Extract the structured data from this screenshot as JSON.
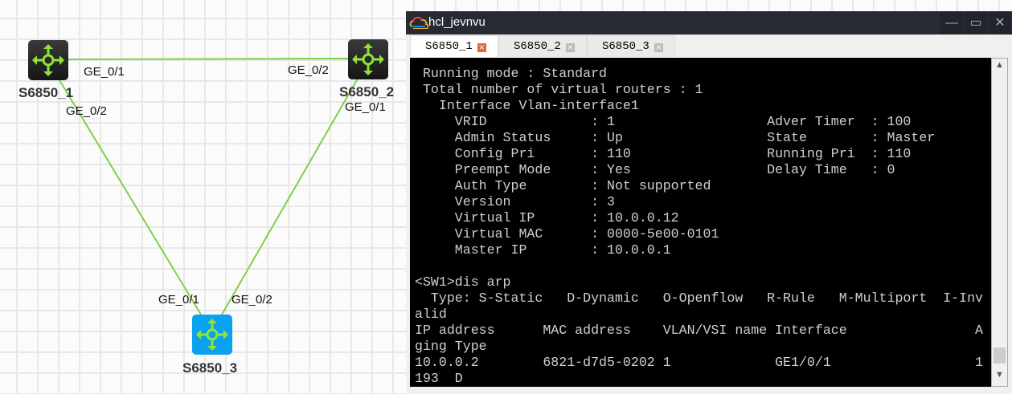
{
  "topology": {
    "devices": [
      {
        "name": "S6850_1",
        "color": "#222222"
      },
      {
        "name": "S6850_2",
        "color": "#222222"
      },
      {
        "name": "S6850_3",
        "color": "#0aa2f0"
      }
    ],
    "link_color": "#7ed04a",
    "ports": {
      "s1_to_s2": "GE_0/1",
      "s2_to_s1": "GE_0/2",
      "s1_to_s3": "GE_0/2",
      "s2_to_s3": "GE_0/1",
      "s3_to_s1": "GE_0/1",
      "s3_to_s2": "GE_0/2"
    }
  },
  "window": {
    "title": "hcl_jevnvu",
    "minimize": "—",
    "maximize": "▭",
    "close": "✕",
    "tabs": [
      {
        "label": "S6850_1",
        "active": true
      },
      {
        "label": "S6850_2",
        "active": false
      },
      {
        "label": "S6850_3",
        "active": false
      }
    ],
    "terminal_lines": [
      " Running mode : Standard",
      " Total number of virtual routers : 1",
      "   Interface Vlan-interface1",
      "     VRID             : 1                   Adver Timer  : 100",
      "     Admin Status     : Up                  State        : Master",
      "     Config Pri       : 110                 Running Pri  : 110",
      "     Preempt Mode     : Yes                 Delay Time   : 0",
      "     Auth Type        : Not supported",
      "     Version          : 3",
      "     Virtual IP       : 10.0.0.12",
      "     Virtual MAC      : 0000-5e00-0101",
      "     Master IP        : 10.0.0.1",
      "",
      "<SW1>dis arp",
      "  Type: S-Static   D-Dynamic   O-Openflow   R-Rule   M-Multiport  I-Inv",
      "alid",
      "IP address      MAC address    VLAN/VSI name Interface                A",
      "ging Type",
      "10.0.0.2        6821-d7d5-0202 1             GE1/0/1                  1",
      "193  D"
    ]
  }
}
